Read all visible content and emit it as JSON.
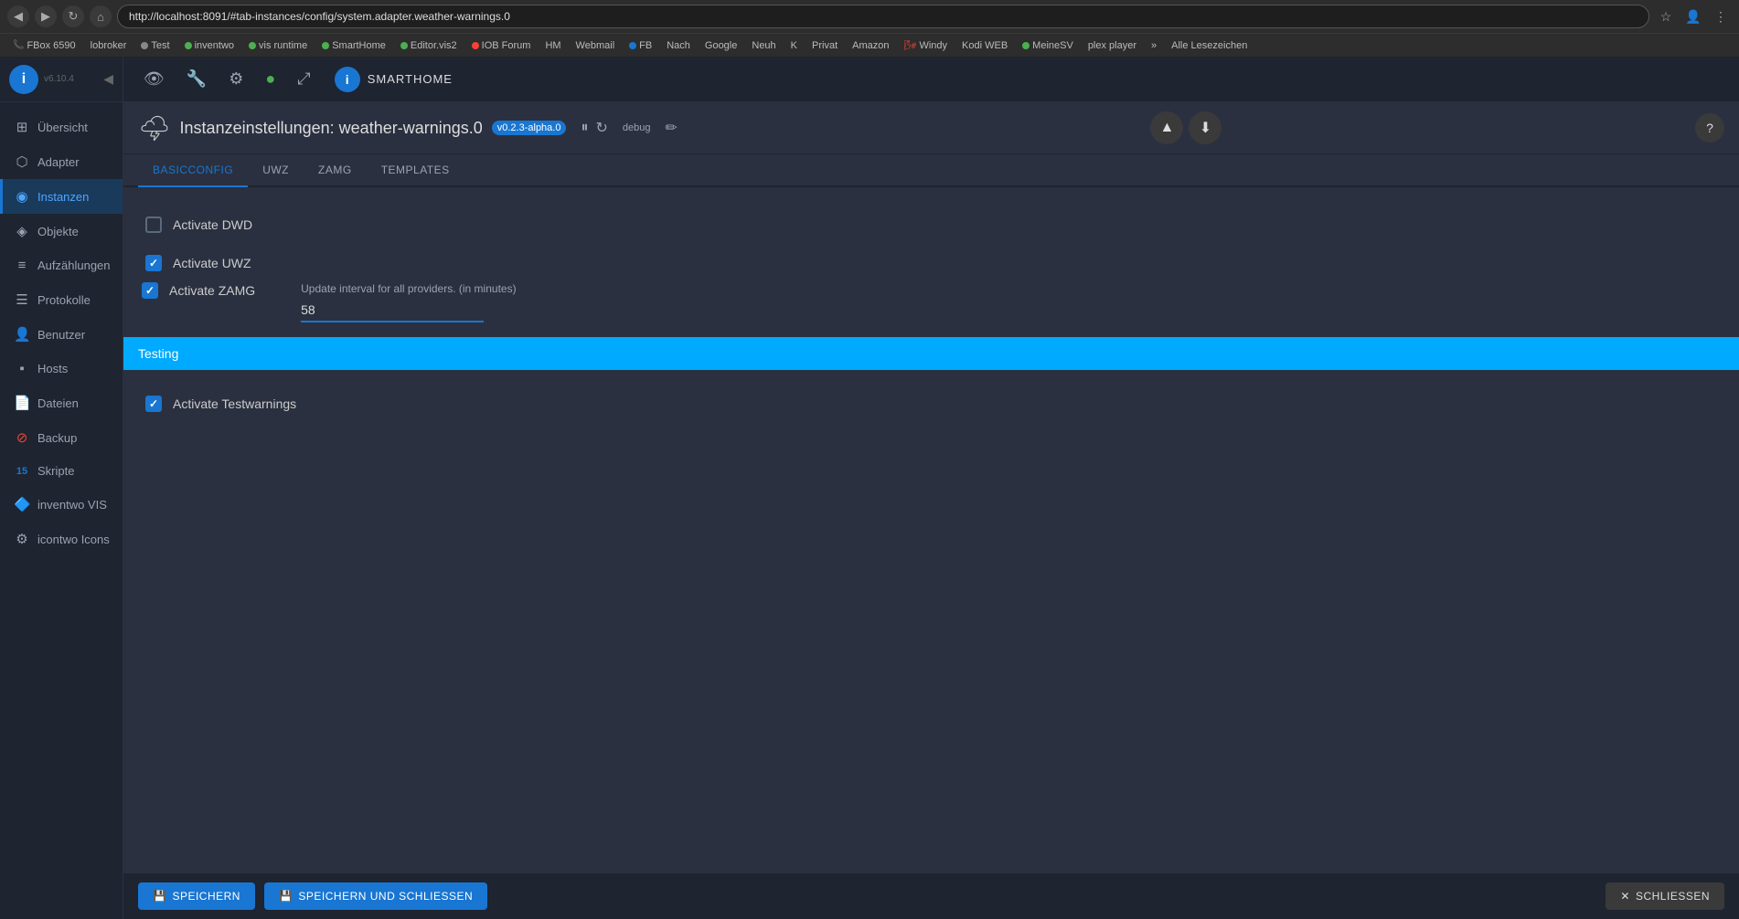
{
  "browser": {
    "url": "http://localhost:8091/#tab-instances/config/system.adapter.weather-warnings.0",
    "nav_back": "◀",
    "nav_forward": "▶",
    "nav_refresh": "↻",
    "nav_home": "⌂"
  },
  "bookmarks": [
    {
      "label": "FBox 6590",
      "color": "#ff6600"
    },
    {
      "label": "lobroker",
      "color": null
    },
    {
      "label": "Test",
      "color": "#888"
    },
    {
      "label": "inventwo",
      "color": "#4caf50"
    },
    {
      "label": "vis runtime",
      "color": "#4caf50"
    },
    {
      "label": "SmartHome",
      "color": "#4caf50"
    },
    {
      "label": "Editor.vis2",
      "color": "#4caf50"
    },
    {
      "label": "IOB Forum",
      "color": "#f44336"
    },
    {
      "label": "HM",
      "color": "#888"
    },
    {
      "label": "Webmail",
      "color": "#888"
    },
    {
      "label": "FB",
      "color": "#1976d2"
    },
    {
      "label": "Nach",
      "color": null
    },
    {
      "label": "Google",
      "color": null
    },
    {
      "label": "Neuh",
      "color": null
    },
    {
      "label": "K",
      "color": null
    },
    {
      "label": "Privat",
      "color": null
    },
    {
      "label": "Amazon",
      "color": null
    },
    {
      "label": "Windy",
      "color": "#f44336"
    },
    {
      "label": "Kodi WEB",
      "color": "#2196f3"
    },
    {
      "label": "MeineSV",
      "color": "#4caf50"
    },
    {
      "label": "plex player",
      "color": null
    }
  ],
  "sidebar": {
    "logo": "i",
    "version": "v6.10.4",
    "collapse_icon": "◀",
    "items": [
      {
        "label": "Übersicht",
        "icon": "⊞",
        "active": false
      },
      {
        "label": "Adapter",
        "icon": "⬡",
        "active": false
      },
      {
        "label": "Instanzen",
        "icon": "◉",
        "active": true
      },
      {
        "label": "Objekte",
        "icon": "◈",
        "active": false
      },
      {
        "label": "Aufzählungen",
        "icon": "≡",
        "active": false
      },
      {
        "label": "Protokolle",
        "icon": "☰",
        "active": false
      },
      {
        "label": "Benutzer",
        "icon": "👤",
        "active": false
      },
      {
        "label": "Hosts",
        "icon": "⬛",
        "active": false
      },
      {
        "label": "Dateien",
        "icon": "📄",
        "active": false
      },
      {
        "label": "Backup",
        "icon": "🔴",
        "active": false
      },
      {
        "label": "Skripte",
        "icon": "15",
        "active": false
      },
      {
        "label": "inventwo VIS",
        "icon": "🔷",
        "active": false
      },
      {
        "label": "icontwo Icons",
        "icon": "⚙",
        "active": false
      }
    ]
  },
  "toolbar": {
    "eye_icon": "👁",
    "wrench_icon": "🔧",
    "gear_icon": "⚙",
    "green_icon": "🟢",
    "expand_icon": "⤢",
    "brand_logo": "i",
    "brand_name": "SMARTHOME"
  },
  "instance": {
    "icon": "🌩",
    "title": "Instanzeinstellungen: weather-warnings.0",
    "version": "v0.2.3-alpha.0",
    "pause_icon": "⏸",
    "refresh_icon": "↻",
    "badge": "debug",
    "edit_icon": "✏",
    "help_icon": "?",
    "arrow_up": "▲",
    "arrow_down": "⬇"
  },
  "tabs": [
    {
      "label": "BASICCONFIG",
      "active": true
    },
    {
      "label": "UWZ",
      "active": false
    },
    {
      "label": "ZAMG",
      "active": false
    },
    {
      "label": "TEMPLATES",
      "active": false
    }
  ],
  "config": {
    "activate_dwd": {
      "label": "Activate DWD",
      "checked": false
    },
    "activate_uwz": {
      "label": "Activate UWZ",
      "checked": true
    },
    "activate_zamg": {
      "label": "Activate ZAMG",
      "checked": true
    },
    "update_interval_label": "Update interval for all providers. (in minutes)",
    "update_interval_value": "58",
    "testing_section": "Testing",
    "activate_testwarnings": {
      "label": "Activate Testwarnings",
      "checked": true
    }
  },
  "bottom_bar": {
    "save_icon": "💾",
    "save_label": "SPEICHERN",
    "save_close_icon": "💾",
    "save_close_label": "SPEICHERN UND SCHLIESSEN",
    "close_icon": "✕",
    "close_label": "SCHLIESSEN"
  }
}
